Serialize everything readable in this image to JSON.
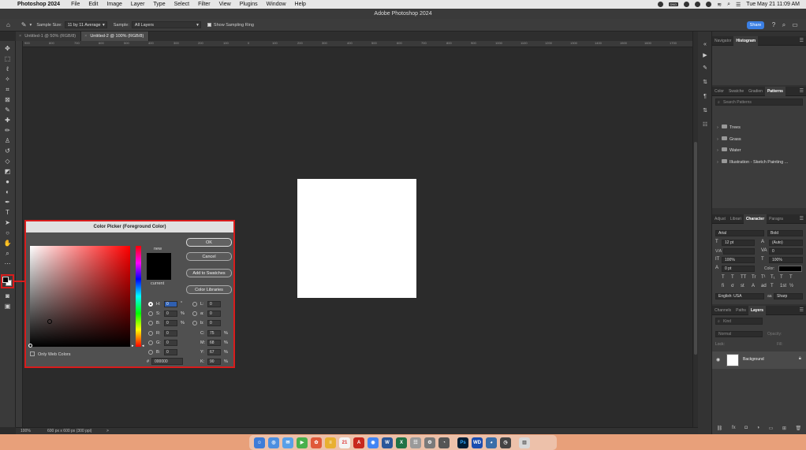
{
  "menubar": {
    "app_name": "Photoshop 2024",
    "items": [
      "File",
      "Edit",
      "Image",
      "Layer",
      "Type",
      "Select",
      "Filter",
      "View",
      "Plugins",
      "Window",
      "Help"
    ],
    "badge": "DND",
    "clock": "Tue May 21  11:09 AM"
  },
  "window": {
    "title": "Adobe Photoshop 2024"
  },
  "options": {
    "sample_size_label": "Sample Size:",
    "sample_size_value": "11 by 11 Average",
    "sample_label": "Sample:",
    "sample_value": "All Layers",
    "show_ring_label": "Show Sampling Ring",
    "share_label": "Share"
  },
  "tabs": [
    {
      "label": "Untitled-1 @ 50% (RGB/8)",
      "active": false
    },
    {
      "label": "Untitled-2 @ 100% (RGB/8)",
      "active": true
    }
  ],
  "ruler": {
    "ticks": [
      "900",
      "800",
      "700",
      "600",
      "500",
      "400",
      "300",
      "200",
      "100",
      "0",
      "100",
      "200",
      "300",
      "400",
      "500",
      "600",
      "700",
      "800",
      "900",
      "1000",
      "1100",
      "1200",
      "1300",
      "1400",
      "1500",
      "1600",
      "1700"
    ]
  },
  "status": {
    "zoom": "100%",
    "doc_info": "600 px x 600 px (300 ppi)",
    "arrow": ">"
  },
  "panels": {
    "top_tabs": [
      "Navigator",
      "Histogram"
    ],
    "top_active": 1,
    "patterns_tabs": [
      "Color",
      "Swatche",
      "Gradien",
      "Patterns"
    ],
    "patterns_active": 3,
    "patterns_search": "Search Patterns",
    "pattern_groups": [
      "Trees",
      "Grass",
      "Water",
      "Illustration - Sketch Painting ..."
    ],
    "char_tabs": [
      "Adjust",
      "Librari",
      "Character",
      "Paragra"
    ],
    "char_active": 2,
    "character": {
      "font": "Arial",
      "style": "Bold",
      "size": "12 pt",
      "leading": "(Auto)",
      "kerning": "V/A",
      "tracking": "0",
      "vscale": "100%",
      "hscale": "100%",
      "baseline": "0 pt",
      "color_label": "Color:",
      "language": "English: USA",
      "aa": "Sharp",
      "glyphs": [
        "T",
        "T",
        "TT",
        "Tr",
        "T¹",
        "T₁",
        "T",
        "T"
      ],
      "glyphs2": [
        "fi",
        "σ",
        "st",
        "A",
        "ad",
        "T",
        "1st",
        "½"
      ],
      "aa_icon": "aa"
    },
    "layers_tabs": [
      "Channels",
      "Paths",
      "Layers"
    ],
    "layers_active": 2,
    "layers_search": "Kind",
    "blend_mode": "Normal",
    "opacity_label": "Opacity:",
    "lock_label": "Lock:",
    "fill_label": "Fill:",
    "layer_name": "Background"
  },
  "picker": {
    "title": "Color Picker (Foreground Color)",
    "new_label": "new",
    "current_label": "current",
    "ok": "OK",
    "cancel": "Cancel",
    "add_swatches": "Add to Swatches",
    "color_libraries": "Color Libraries",
    "only_web": "Only Web Colors",
    "hash": "#",
    "hex": "000000",
    "fields": {
      "H": "0",
      "S": "0",
      "B": "0",
      "R": "0",
      "G": "0",
      "Bb": "0",
      "L": "0",
      "a": "0",
      "b": "0",
      "C": "75",
      "M": "68",
      "Y": "67",
      "K": "90"
    },
    "units": {
      "deg": "°",
      "pct": "%"
    }
  },
  "colors": {
    "accent": "#3b7fe3",
    "highlight": "#d81c1c",
    "foreground": "#000000",
    "background": "#ffffff"
  }
}
